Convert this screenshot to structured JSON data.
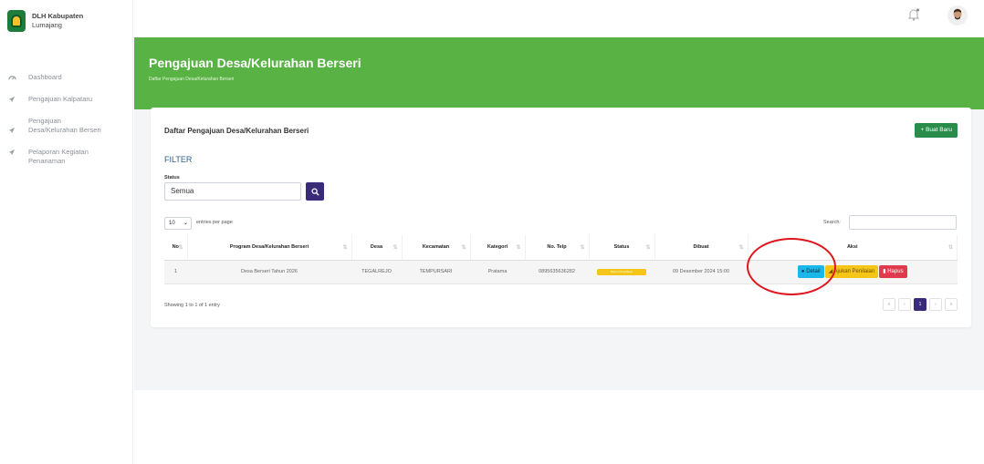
{
  "brand": {
    "name_line1": "DLH Kabupaten",
    "name_line2": "Lumajang"
  },
  "sidebar": {
    "items": [
      {
        "label": "Dashboard",
        "icon": "dashboard-icon"
      },
      {
        "label": "Pengajuan Kalpataru",
        "icon": "send-icon"
      },
      {
        "label": "Pengajuan Desa/Kelurahan Berseri",
        "icon": "send-icon"
      },
      {
        "label": "Pelaporan Kegiatan Penanaman",
        "icon": "send-icon"
      }
    ]
  },
  "topbar": {
    "bell_icon": "bell-icon",
    "avatar_icon": "user-avatar-icon"
  },
  "header": {
    "title": "Pengajuan Desa/Kelurahan Berseri",
    "breadcrumb": "Daftar Pengajuan Desa/Kelurahan Berseri"
  },
  "card": {
    "title": "Daftar Pengajuan Desa/Kelurahan Berseri",
    "new_button": "+ Buat Baru",
    "filter_title": "FILTER",
    "status_label": "Status",
    "status_value": "Semua",
    "length_value": "10",
    "length_text": "entries per page",
    "search_label": "Search:",
    "showing": "Showing 1 to 1 of 1 entry"
  },
  "table": {
    "headers": [
      "No",
      "Program Desa/Kelurahan Berseri",
      "Desa",
      "Kecamatan",
      "Kategori",
      "No. Telp",
      "Status",
      "Dibuat",
      "Aksi"
    ],
    "rows": [
      {
        "no": "1",
        "program": "Desa Berseri Tahun 2026",
        "desa": "TEGALREJO",
        "kecamatan": "TEMPURSARI",
        "kategori": "Pratama",
        "telp": "0895635636282",
        "status": "Belum Diverifikasi",
        "dibuat": "09 Desember 2024 15:00"
      }
    ],
    "actions": {
      "detail": "Detail",
      "ajukan": "Ajukan Penilaian",
      "hapus": "Hapus"
    }
  },
  "pagination": {
    "first": "«",
    "prev": "‹",
    "current": "1",
    "next": "›",
    "last": "»"
  },
  "colors": {
    "header_green": "#58b244",
    "primary_purple": "#3a2a7a",
    "annotation_red": "#e0161f"
  }
}
